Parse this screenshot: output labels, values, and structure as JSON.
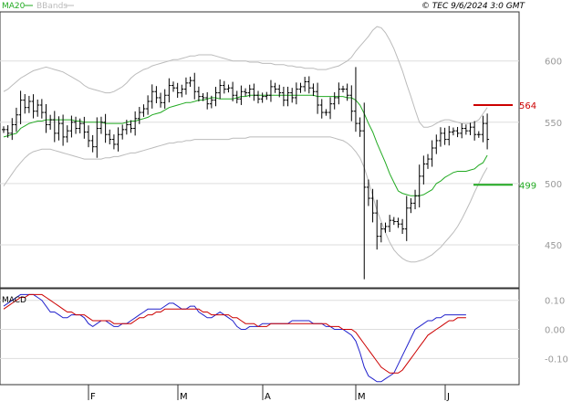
{
  "header": {
    "legend_ma": "MA20",
    "legend_bb": "BBands",
    "copyright": "© TEC 9/6/2024 3:0 GMT"
  },
  "colors": {
    "price": "#000000",
    "ma": "#22aa22",
    "bands": "#bbbbbb",
    "grid": "#dddddd",
    "axis": "#333333",
    "resistance": "#cc0000",
    "support": "#22aa22",
    "macd": "#2222cc",
    "signal": "#cc0000",
    "tick_text": "#999999"
  },
  "chart_data": [
    {
      "type": "ohlc",
      "x_ticks": [
        "F",
        "M",
        "A",
        "M",
        "J"
      ],
      "x_tick_index": [
        20,
        41,
        61,
        83,
        104
      ],
      "y_ticks": [
        "600",
        "550",
        "500",
        "450"
      ],
      "y_tick_values": [
        600,
        550,
        500,
        450
      ],
      "ylim": [
        415,
        640
      ],
      "levels": [
        {
          "name": "resistance",
          "label": "564",
          "value": 564
        },
        {
          "name": "support",
          "label": "499",
          "value": 499
        }
      ],
      "closes": [
        544,
        541,
        548,
        556,
        568,
        562,
        567,
        559,
        564,
        558,
        548,
        552,
        541,
        549,
        538,
        543,
        550,
        545,
        549,
        542,
        535,
        530,
        545,
        550,
        540,
        536,
        532,
        540,
        544,
        548,
        545,
        553,
        558,
        561,
        567,
        575,
        570,
        566,
        572,
        580,
        578,
        574,
        577,
        582,
        584,
        575,
        571,
        570,
        565,
        568,
        574,
        580,
        577,
        578,
        572,
        569,
        575,
        574,
        577,
        572,
        569,
        571,
        572,
        579,
        577,
        574,
        568,
        574,
        570,
        577,
        579,
        583,
        578,
        575,
        564,
        558,
        558,
        565,
        570,
        577,
        577,
        572,
        559,
        549,
        543,
        497,
        488,
        476,
        457,
        463,
        465,
        470,
        469,
        467,
        463,
        480,
        484,
        490,
        506,
        516,
        520,
        529,
        535,
        541,
        536,
        542,
        543,
        541,
        545,
        543,
        546,
        540,
        540,
        549,
        536
      ],
      "ma20": [
        538,
        539,
        540,
        541,
        545,
        547,
        549,
        550,
        551,
        551,
        552,
        552,
        552,
        552,
        552,
        552,
        552,
        551,
        551,
        550,
        550,
        550,
        550,
        550,
        549,
        549,
        549,
        549,
        549,
        550,
        551,
        551,
        552,
        553,
        554,
        556,
        557,
        558,
        560,
        562,
        563,
        564,
        565,
        566,
        566,
        567,
        568,
        568,
        569,
        570,
        570,
        569,
        569,
        569,
        569,
        570,
        571,
        571,
        572,
        572,
        572,
        572,
        572,
        572,
        572,
        572,
        572,
        572,
        572,
        572,
        572,
        572,
        572,
        572,
        571,
        571,
        571,
        571,
        571,
        571,
        571,
        570,
        570,
        568,
        564,
        557,
        549,
        542,
        533,
        525,
        517,
        508,
        501,
        494,
        492,
        491,
        490,
        490,
        490,
        491,
        493,
        495,
        500,
        502,
        505,
        507,
        509,
        510,
        510,
        510,
        511,
        512,
        515,
        517,
        523
      ],
      "upper_band": [
        575,
        577,
        580,
        583,
        586,
        588,
        590,
        592,
        593,
        594,
        595,
        594,
        593,
        592,
        591,
        589,
        587,
        585,
        583,
        580,
        578,
        577,
        576,
        575,
        574,
        574,
        575,
        577,
        579,
        582,
        586,
        589,
        591,
        593,
        594,
        596,
        597,
        598,
        599,
        600,
        601,
        601,
        602,
        603,
        604,
        604,
        605,
        605,
        605,
        605,
        604,
        603,
        602,
        601,
        600,
        600,
        600,
        600,
        599,
        599,
        599,
        598,
        598,
        598,
        597,
        597,
        597,
        596,
        596,
        595,
        595,
        594,
        594,
        594,
        593,
        593,
        593,
        594,
        595,
        596,
        598,
        600,
        603,
        608,
        612,
        616,
        620,
        625,
        628,
        627,
        623,
        617,
        610,
        601,
        592,
        581,
        571,
        560,
        550,
        546,
        546,
        547,
        549,
        551,
        552,
        552,
        551,
        550,
        549,
        549,
        549,
        550,
        552,
        557,
        562
      ],
      "lower_band": [
        498,
        503,
        508,
        513,
        517,
        521,
        524,
        526,
        527,
        528,
        528,
        528,
        527,
        526,
        525,
        524,
        523,
        522,
        521,
        520,
        520,
        520,
        520,
        520,
        521,
        521,
        522,
        522,
        523,
        524,
        525,
        525,
        526,
        527,
        528,
        529,
        530,
        531,
        532,
        533,
        533,
        534,
        534,
        535,
        535,
        536,
        536,
        536,
        536,
        536,
        536,
        536,
        536,
        536,
        537,
        537,
        537,
        537,
        538,
        538,
        538,
        538,
        538,
        538,
        538,
        538,
        538,
        538,
        538,
        538,
        538,
        538,
        538,
        538,
        538,
        538,
        538,
        538,
        537,
        536,
        535,
        533,
        530,
        526,
        521,
        513,
        502,
        490,
        478,
        469,
        460,
        452,
        446,
        442,
        439,
        437,
        436,
        436,
        437,
        438,
        440,
        442,
        445,
        448,
        452,
        456,
        460,
        465,
        471,
        478,
        485,
        493,
        500,
        507,
        513
      ]
    },
    {
      "type": "line",
      "title": "MACD",
      "y_ticks": [
        "0.10",
        "0.00",
        "-0.10"
      ],
      "y_tick_values": [
        0.1,
        0.0,
        -0.1
      ],
      "ylim": [
        -0.19,
        0.14
      ],
      "series": [
        {
          "name": "MACD",
          "values": [
            0.08,
            0.09,
            0.1,
            0.11,
            0.12,
            0.12,
            0.12,
            0.12,
            0.11,
            0.1,
            0.08,
            0.06,
            0.06,
            0.05,
            0.04,
            0.04,
            0.05,
            0.05,
            0.05,
            0.04,
            0.02,
            0.01,
            0.02,
            0.03,
            0.03,
            0.02,
            0.01,
            0.01,
            0.02,
            0.02,
            0.03,
            0.04,
            0.05,
            0.06,
            0.07,
            0.07,
            0.07,
            0.07,
            0.08,
            0.09,
            0.09,
            0.08,
            0.07,
            0.07,
            0.08,
            0.08,
            0.06,
            0.05,
            0.04,
            0.04,
            0.05,
            0.06,
            0.05,
            0.04,
            0.03,
            0.01,
            0.0,
            0.0,
            0.01,
            0.01,
            0.01,
            0.02,
            0.02,
            0.02,
            0.02,
            0.02,
            0.02,
            0.02,
            0.03,
            0.03,
            0.03,
            0.03,
            0.03,
            0.02,
            0.02,
            0.02,
            0.01,
            0.01,
            0.0,
            0.0,
            0.0,
            -0.01,
            -0.02,
            -0.04,
            -0.08,
            -0.13,
            -0.16,
            -0.17,
            -0.18,
            -0.18,
            -0.17,
            -0.16,
            -0.15,
            -0.12,
            -0.09,
            -0.06,
            -0.03,
            0.0,
            0.01,
            0.02,
            0.03,
            0.03,
            0.04,
            0.04,
            0.05,
            0.05,
            0.05,
            0.05,
            0.05,
            0.05
          ]
        },
        {
          "name": "Signal",
          "values": [
            0.07,
            0.08,
            0.09,
            0.1,
            0.11,
            0.11,
            0.12,
            0.12,
            0.12,
            0.12,
            0.11,
            0.1,
            0.09,
            0.08,
            0.07,
            0.06,
            0.06,
            0.05,
            0.05,
            0.05,
            0.04,
            0.03,
            0.03,
            0.03,
            0.03,
            0.03,
            0.02,
            0.02,
            0.02,
            0.02,
            0.02,
            0.03,
            0.04,
            0.04,
            0.05,
            0.05,
            0.06,
            0.06,
            0.07,
            0.07,
            0.07,
            0.07,
            0.07,
            0.07,
            0.07,
            0.07,
            0.07,
            0.06,
            0.06,
            0.05,
            0.05,
            0.05,
            0.05,
            0.05,
            0.04,
            0.04,
            0.03,
            0.02,
            0.02,
            0.02,
            0.01,
            0.01,
            0.01,
            0.02,
            0.02,
            0.02,
            0.02,
            0.02,
            0.02,
            0.02,
            0.02,
            0.02,
            0.02,
            0.02,
            0.02,
            0.02,
            0.02,
            0.01,
            0.01,
            0.01,
            0.0,
            0.0,
            0.0,
            -0.01,
            -0.03,
            -0.05,
            -0.07,
            -0.09,
            -0.11,
            -0.13,
            -0.14,
            -0.15,
            -0.15,
            -0.15,
            -0.14,
            -0.12,
            -0.1,
            -0.08,
            -0.06,
            -0.04,
            -0.02,
            -0.01,
            0.0,
            0.01,
            0.02,
            0.03,
            0.03,
            0.04,
            0.04,
            0.04
          ]
        }
      ]
    }
  ]
}
